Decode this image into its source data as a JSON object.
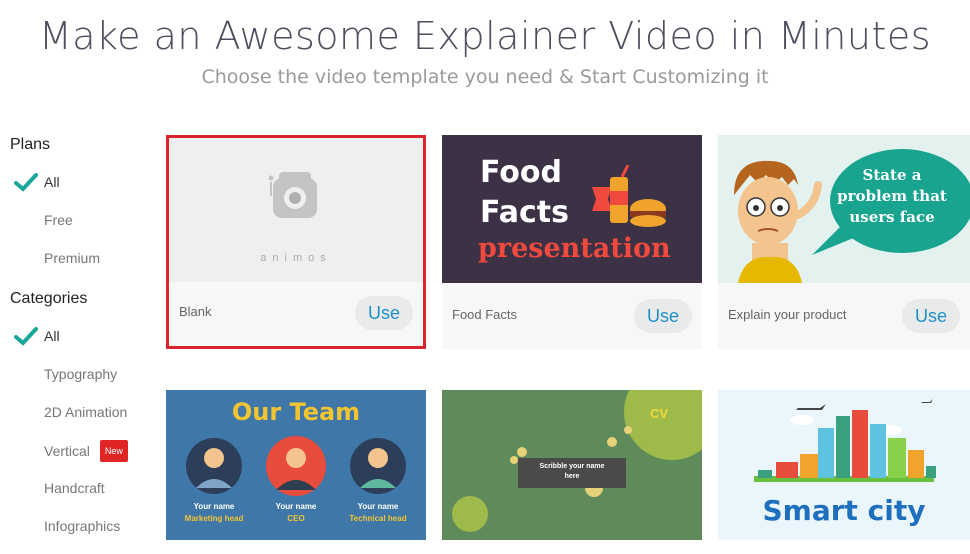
{
  "hero": {
    "title": "Make an Awesome Explainer Video in Minutes",
    "subtitle": "Choose the video template you need & Start Customizing it"
  },
  "sidebar": {
    "plans_heading": "Plans",
    "plans": [
      {
        "label": "All",
        "active": true
      },
      {
        "label": "Free",
        "active": false
      },
      {
        "label": "Premium",
        "active": false
      }
    ],
    "categories_heading": "Categories",
    "categories": [
      {
        "label": "All",
        "active": true
      },
      {
        "label": "Typography",
        "active": false
      },
      {
        "label": "2D Animation",
        "active": false
      },
      {
        "label": "Vertical",
        "active": false,
        "badge": "New"
      },
      {
        "label": "Handcraft",
        "active": false
      },
      {
        "label": "Infographics",
        "active": false
      }
    ]
  },
  "templates": [
    {
      "name": "Blank",
      "use_label": "Use",
      "thumb_text": "animos",
      "selected": true
    },
    {
      "name": "Food Facts",
      "use_label": "Use",
      "thumb_lines": [
        "Food",
        "Facts",
        "presentation"
      ]
    },
    {
      "name": "Explain your product",
      "use_label": "Use",
      "thumb_lines": [
        "State a",
        "problem that",
        "users face"
      ]
    },
    {
      "thumb_title": "Our Team",
      "people": [
        {
          "name": "Your name",
          "role": "Marketing head"
        },
        {
          "name": "Your name",
          "role": "CEO"
        },
        {
          "name": "Your name",
          "role": "Technical head"
        }
      ]
    },
    {
      "thumb_corner": "CV",
      "thumb_lines": [
        "Scribble your name",
        "here"
      ]
    },
    {
      "thumb_title": "Smart city"
    }
  ],
  "colors": {
    "accent_blue": "#1f8fc7",
    "selected_border": "#d9232d",
    "check_teal": "#1aa79a",
    "food_bg": "#3d3146",
    "team_bg": "#3f78a8",
    "cv_bg": "#5f8b5a"
  }
}
